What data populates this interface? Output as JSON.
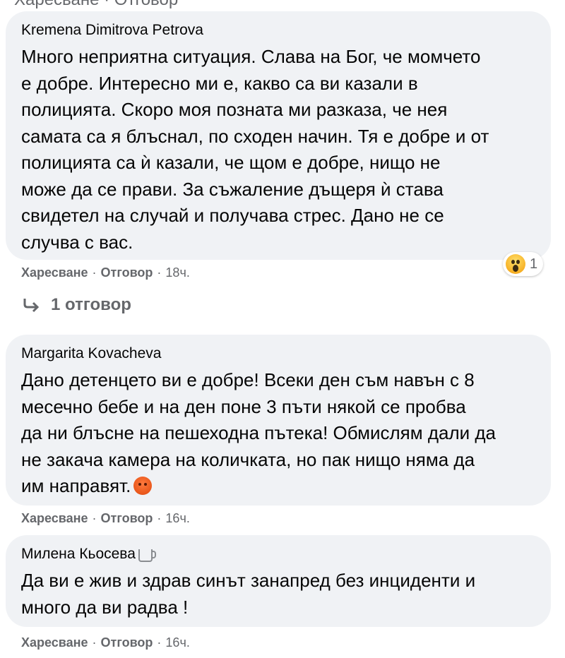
{
  "top_cut": "Харесване · Отговор",
  "comments": [
    {
      "author": "Kremena Dimitrova Petrova",
      "text": "Много неприятна ситуация. Слава на Бог, че момчето\nе добре. Интересно ми е, какво са ви казали в\nполицията. Скоро моя позната ми разказа, че нея\nсамата са я блъснал, по сходен начин. Тя е добре и от\nполицията са ѝ казали, че щом е добре, нищо не\nможе да се прави. За съжаление дъщеря ѝ става\nсвидетел на случай и получава стрес. Дано не се\nслучва с вас.",
      "like": "Харесване",
      "reply": "Отговор",
      "time": "18ч.",
      "reaction": {
        "icon": "wow-reaction-icon",
        "count": "1"
      }
    },
    {
      "author": "Margarita Kovacheva",
      "text": "Дано детенцето ви е добре! Всеки ден съм навън с 8\nмесечно бебе и на ден поне 3 пъти някой се пробва\nда ни блъсне на пешеходна пътека! Обмислям дали да\nне закача камера на количката, но пак нищо няма да\nим направят.",
      "emoji": "angry-emoji-icon",
      "like": "Харесване",
      "reply": "Отговор",
      "time": "16ч."
    },
    {
      "author": "Милена Кьосева",
      "badge": "coffee-icon",
      "text": "Да ви е жив и здрав синът занапред без инциденти и\nмного да ви радва !",
      "like": "Харесване",
      "reply": "Отговор",
      "time": "16ч."
    }
  ],
  "replies_link": "1 отговор",
  "colors": {
    "bubble": "#f0f2f5",
    "secondary_text": "#65676b",
    "text": "#050505"
  }
}
